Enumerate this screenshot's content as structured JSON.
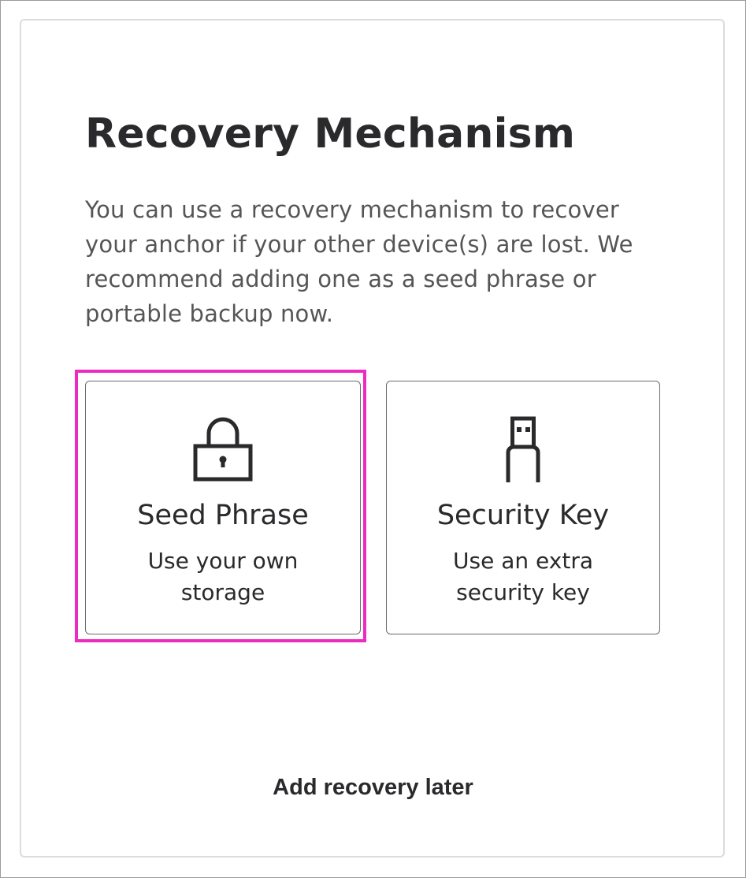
{
  "page": {
    "title": "Recovery Mechanism",
    "description": "You can use a recovery mechanism to recover your anchor if your other device(s) are lost. We recommend adding one as a seed phrase or portable backup now."
  },
  "options": [
    {
      "id": "seed-phrase",
      "icon": "lock-icon",
      "title": "Seed Phrase",
      "subtitle": "Use your own storage",
      "highlighted": true
    },
    {
      "id": "security-key",
      "icon": "usb-key-icon",
      "title": "Security Key",
      "subtitle": "Use an extra security key",
      "highlighted": false
    }
  ],
  "actions": {
    "later_label": "Add recovery later"
  },
  "colors": {
    "highlight": "#ec2cc0",
    "text": "#2a2a2d",
    "muted_text": "#555557",
    "border": "#6a6a6e"
  }
}
